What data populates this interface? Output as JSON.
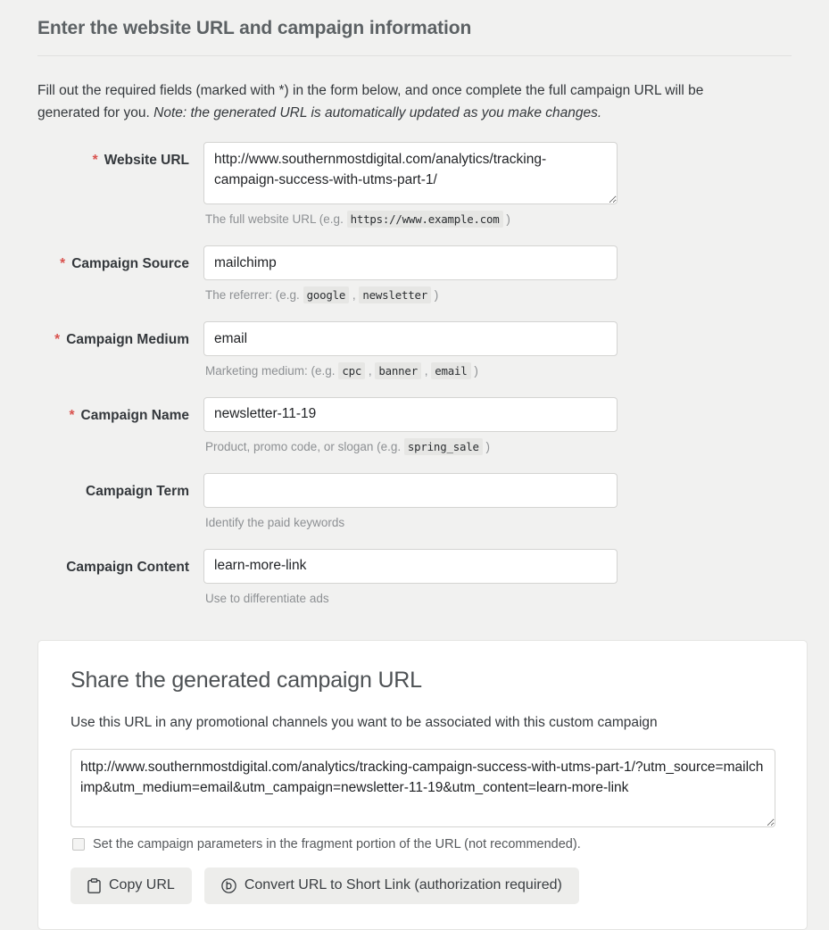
{
  "header": {
    "title": "Enter the website URL and campaign information"
  },
  "intro": {
    "text_main": "Fill out the required fields (marked with *) in the form below, and once complete the full campaign URL will be generated for you.",
    "text_note": "Note: the generated URL is automatically updated as you make changes."
  },
  "form": {
    "fields": [
      {
        "id": "website-url",
        "label": "Website URL",
        "required": true,
        "value": "http://www.southernmostdigital.com/analytics/tracking-campaign-success-with-utms-part-1/",
        "placeholder": "",
        "hint_prefix": "The full website URL (e.g.",
        "hint_codes": [
          "https://www.example.com"
        ],
        "hint_suffix": ")",
        "multiline": true
      },
      {
        "id": "campaign-source",
        "label": "Campaign Source",
        "required": true,
        "value": "mailchimp",
        "placeholder": "",
        "hint_prefix": "The referrer: (e.g.",
        "hint_codes": [
          "google",
          "newsletter"
        ],
        "hint_suffix": ")",
        "multiline": false
      },
      {
        "id": "campaign-medium",
        "label": "Campaign Medium",
        "required": true,
        "value": "email",
        "placeholder": "",
        "hint_prefix": "Marketing medium: (e.g.",
        "hint_codes": [
          "cpc",
          "banner",
          "email"
        ],
        "hint_suffix": ")",
        "multiline": false
      },
      {
        "id": "campaign-name",
        "label": "Campaign Name",
        "required": true,
        "value": "newsletter-11-19",
        "placeholder": "",
        "hint_prefix": "Product, promo code, or slogan (e.g.",
        "hint_codes": [
          "spring_sale"
        ],
        "hint_suffix": ")",
        "multiline": false
      },
      {
        "id": "campaign-term",
        "label": "Campaign Term",
        "required": false,
        "value": "",
        "placeholder": "",
        "hint_prefix": "Identify the paid keywords",
        "hint_codes": [],
        "hint_suffix": "",
        "multiline": false
      },
      {
        "id": "campaign-content",
        "label": "Campaign Content",
        "required": false,
        "value": "learn-more-link",
        "placeholder": "",
        "hint_prefix": "Use to differentiate ads",
        "hint_codes": [],
        "hint_suffix": "",
        "multiline": false
      }
    ],
    "required_marker": "*"
  },
  "share": {
    "title": "Share the generated campaign URL",
    "subtitle": "Use this URL in any promotional channels you want to be associated with this custom campaign",
    "generated_url": "http://www.southernmostdigital.com/analytics/tracking-campaign-success-with-utms-part-1/?utm_source=mailchimp&utm_medium=email&utm_campaign=newsletter-11-19&utm_content=learn-more-link",
    "fragment_checkbox_label": "Set the campaign parameters in the fragment portion of the URL (not recommended).",
    "fragment_checkbox_checked": false,
    "copy_button_label": "Copy URL",
    "copy_button_icon": "clipboard-icon",
    "shortlink_button_label": "Convert URL to Short Link (authorization required)",
    "shortlink_button_icon": "bitly-icon"
  },
  "colors": {
    "page_background": "#f1f1f0",
    "panel_background": "#ffffff",
    "required_star": "#d9534f",
    "title_text": "#5c6164",
    "hint_text": "#8d9093",
    "button_background": "#ededeb"
  }
}
